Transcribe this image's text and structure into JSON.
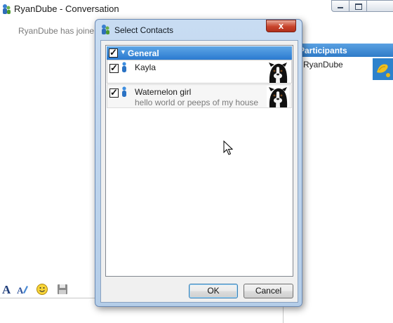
{
  "conversation": {
    "title": "RyanDube - Conversation",
    "message": "RyanDube has joine",
    "participants_header": "Participants",
    "participant_name": "RyanDube",
    "icons": [
      "app-icon",
      "minimize-icon",
      "maximize-icon",
      "close-icon",
      "font-icon",
      "font-color-icon",
      "emoticon-icon",
      "save-icon"
    ]
  },
  "dialog": {
    "title": "Select Contacts",
    "close_label": "x",
    "group": {
      "label": "General",
      "checked": true
    },
    "contacts": [
      {
        "name": "Kayla",
        "status": "",
        "checked": true
      },
      {
        "name": "Waternelon girl",
        "status": "hello world or peeps of my house",
        "checked": true
      }
    ],
    "ok_label": "OK",
    "cancel_label": "Cancel"
  },
  "colors": {
    "group_header": "#2b7ad0",
    "dialog_frame": "#b4cde8",
    "close_button": "#c8442c"
  }
}
